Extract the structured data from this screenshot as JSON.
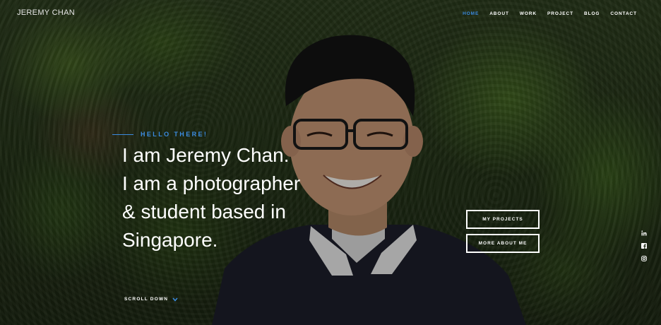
{
  "brand": {
    "name": "JEREMY CHAN"
  },
  "nav": {
    "items": [
      {
        "label": "HOME",
        "active": true
      },
      {
        "label": "ABOUT",
        "active": false
      },
      {
        "label": "WORK",
        "active": false
      },
      {
        "label": "PROJECT",
        "active": false
      },
      {
        "label": "BLOG",
        "active": false
      },
      {
        "label": "CONTACT",
        "active": false
      }
    ]
  },
  "hero": {
    "eyebrow": "HELLO THERE!",
    "headline_lines": [
      "I am Jeremy Chan.",
      "I am a photographer",
      "& student based in",
      "Singapore."
    ]
  },
  "buttons": {
    "projects": "MY PROJECTS",
    "about": "MORE ABOUT ME"
  },
  "scroll": {
    "label": "SCROLL DOWN"
  },
  "socials": [
    "linkedin-icon",
    "facebook-icon",
    "instagram-icon"
  ],
  "colors": {
    "accent": "#3b8be0",
    "text": "#ffffff"
  }
}
